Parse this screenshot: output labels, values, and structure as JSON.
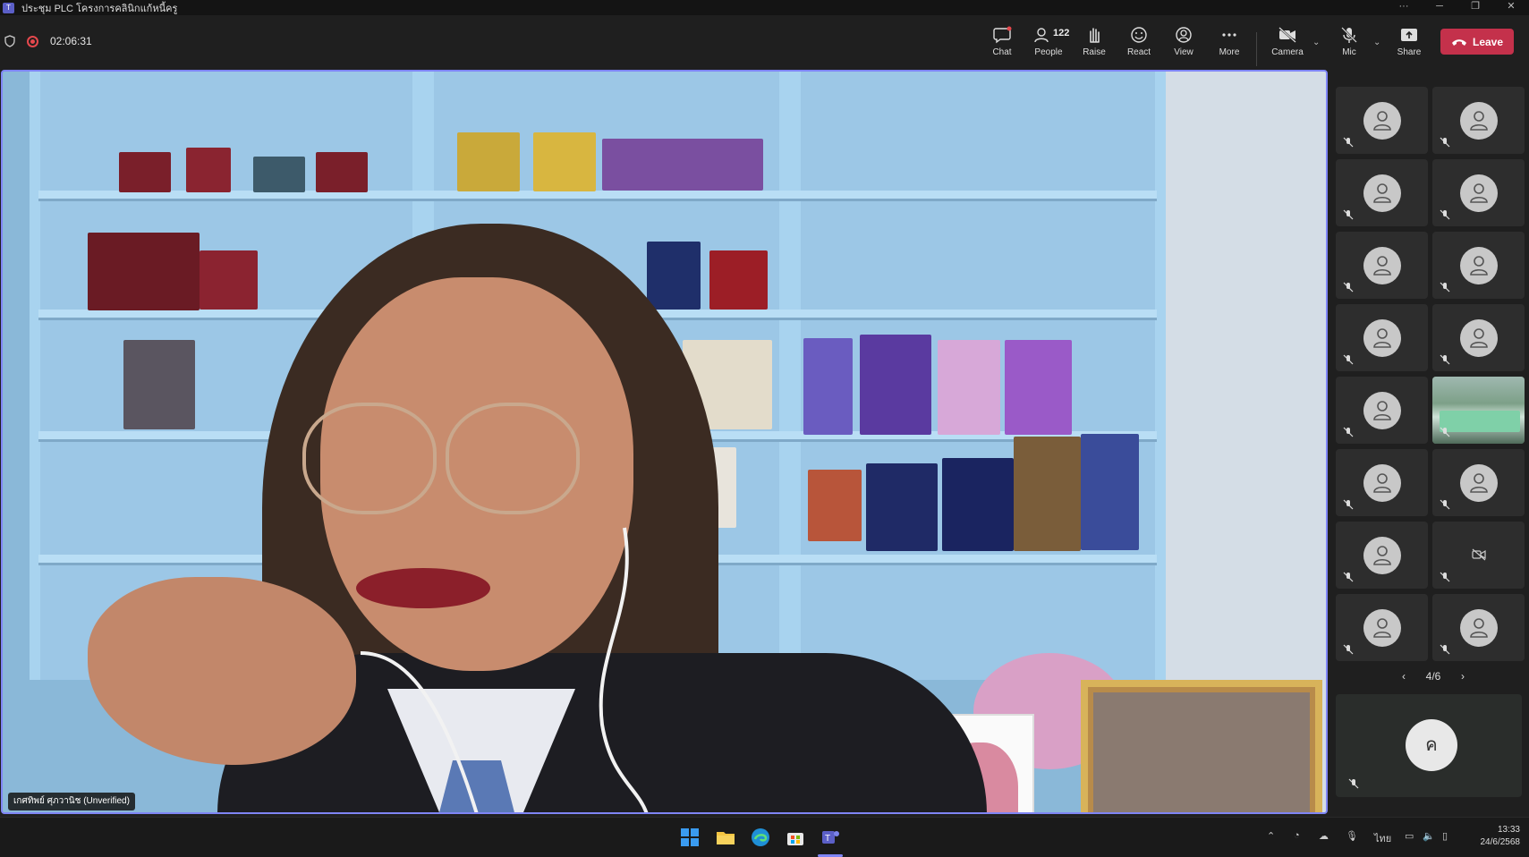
{
  "window": {
    "title": "ประชุม PLC โครงการคลินิกแก้หนี้ครู",
    "controls": [
      "···",
      "─",
      "❐",
      "✕"
    ]
  },
  "meeting": {
    "elapsed": "02:06:31",
    "participant_count": "122",
    "toolbar": {
      "chat": "Chat",
      "people": "People",
      "raise": "Raise",
      "react": "React",
      "view": "View",
      "more": "More",
      "camera": "Camera",
      "mic": "Mic",
      "share": "Share",
      "leave": "Leave"
    }
  },
  "stage": {
    "speaker_name": "เกศทิพย์ ศุภวานิช (Unverified)"
  },
  "gallery": {
    "page": "4/6",
    "self_initial": "ค"
  },
  "taskbar": {
    "language": "ไทย",
    "time": "13:33",
    "date": "24/6/2568"
  },
  "colors": {
    "accent": "#7f85f5",
    "leave": "#c4314b",
    "recording": "#e5484d"
  }
}
